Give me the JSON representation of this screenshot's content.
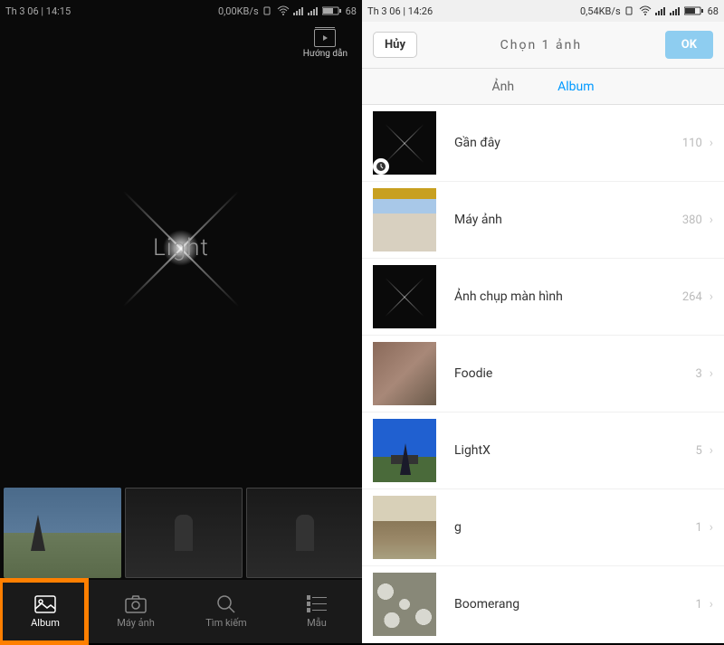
{
  "left": {
    "status": {
      "time": "Th 3 06 | 14:15",
      "speed": "0,00KB/s",
      "battery": "68"
    },
    "guide_label": "Hướng dẫn",
    "logo_text": "Light",
    "nav": {
      "album": "Album",
      "camera": "Máy ảnh",
      "search": "Tìm kiếm",
      "template": "Mẫu"
    }
  },
  "right": {
    "status": {
      "time": "Th 3 06 | 14:26",
      "speed": "0,54KB/s",
      "battery": "68"
    },
    "header": {
      "cancel": "Hủy",
      "title": "Chọn  1  ảnh",
      "ok": "OK"
    },
    "tabs": {
      "photo": "Ảnh",
      "album": "Album"
    },
    "albums": [
      {
        "name": "Gần đây",
        "count": "110"
      },
      {
        "name": "Máy ảnh",
        "count": "380"
      },
      {
        "name": "Ảnh chụp màn hình",
        "count": "264"
      },
      {
        "name": "Foodie",
        "count": "3"
      },
      {
        "name": "LightX",
        "count": "5"
      },
      {
        "name": "g",
        "count": "1"
      },
      {
        "name": "Boomerang",
        "count": "1"
      }
    ]
  }
}
